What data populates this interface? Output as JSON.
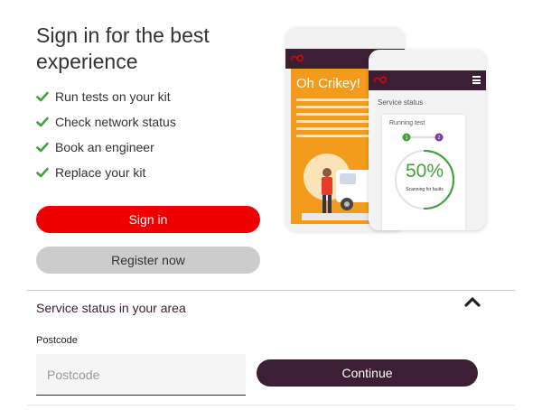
{
  "signin_section": {
    "headline": "Sign in for the best experience",
    "benefits": [
      {
        "icon": "green-check-icon",
        "label": "Run tests on your kit"
      },
      {
        "icon": "green-check-icon",
        "label": "Check network status"
      },
      {
        "icon": "green-check-icon",
        "label": "Book an engineer"
      },
      {
        "icon": "green-check-icon",
        "label": "Replace your kit"
      }
    ],
    "signin_label": "Sign in",
    "register_label": "Register now"
  },
  "illustration": {
    "back_phone": {
      "headline": "Oh Crikey!"
    },
    "front_phone": {
      "title": "Service status",
      "running_label": "Running test",
      "step_from": "1",
      "step_to": "2",
      "progress_text": "50%",
      "progress_fraction": 0.5,
      "progress_caption": "Scanning for faults"
    }
  },
  "service_status": {
    "title": "Service status in your area",
    "postcode_label": "Postcode",
    "postcode_placeholder": "Postcode",
    "postcode_value": "",
    "continue_label": "Continue"
  },
  "colors": {
    "brand_red": "#ee0000",
    "brand_purple": "#3c1f34",
    "check_green": "#44a23a",
    "illustration_orange": "#f29b1d"
  }
}
